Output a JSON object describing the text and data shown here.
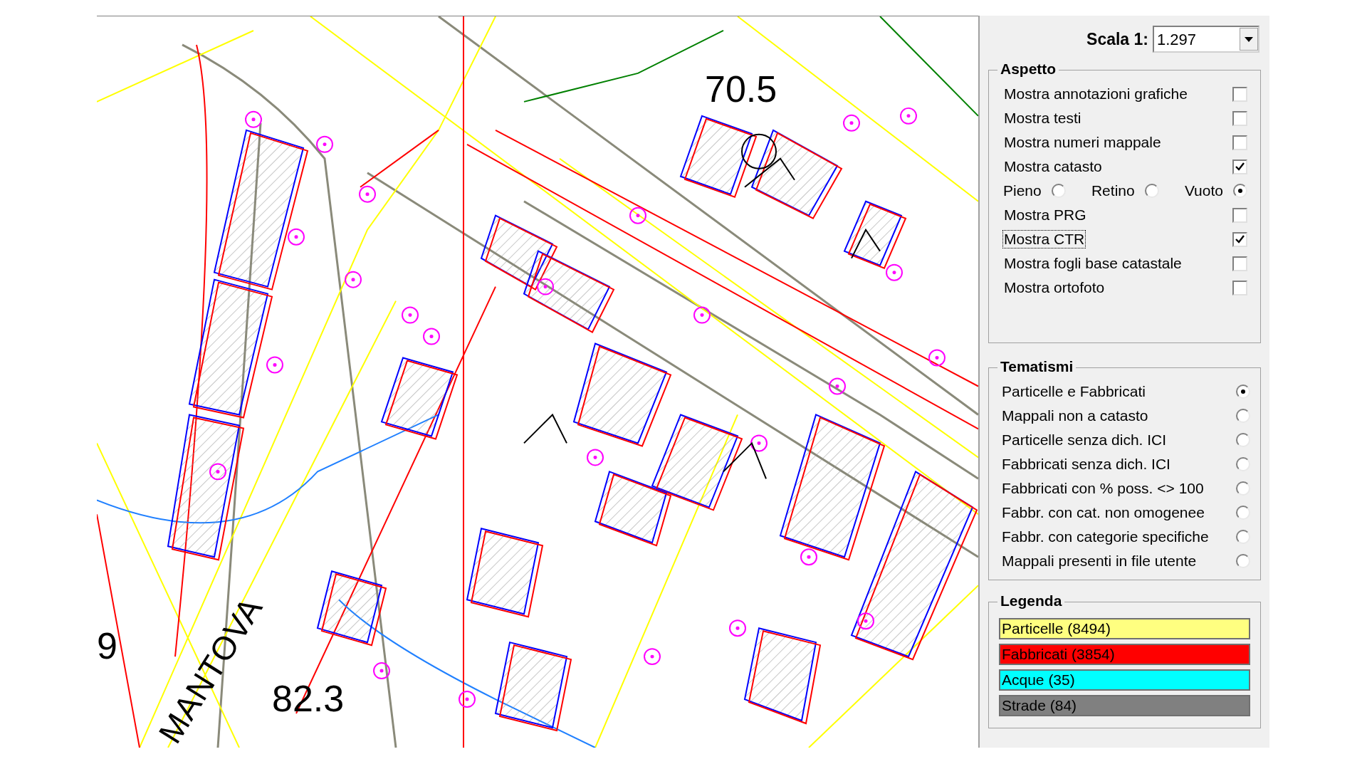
{
  "map": {
    "labels": [
      {
        "kind": "elevation",
        "text": "70.5"
      },
      {
        "kind": "elevation",
        "text": "82.3"
      },
      {
        "kind": "edge",
        "text": "9"
      },
      {
        "kind": "street",
        "text": "MANTOVA"
      }
    ]
  },
  "scale": {
    "label": "Scala 1:",
    "value": "1.297"
  },
  "aspetto": {
    "title": "Aspetto",
    "rows": [
      {
        "kind": "checkbox",
        "label": "Mostra annotazioni grafiche",
        "checked": false,
        "focused": false
      },
      {
        "kind": "checkbox",
        "label": "Mostra testi",
        "checked": false,
        "focused": false
      },
      {
        "kind": "checkbox",
        "label": "Mostra numeri mappale",
        "checked": false,
        "focused": false
      },
      {
        "kind": "checkbox",
        "label": "Mostra catasto",
        "checked": true,
        "focused": false
      },
      {
        "kind": "radios",
        "options": [
          {
            "label": "Pieno",
            "selected": false
          },
          {
            "label": "Retino",
            "selected": false
          },
          {
            "label": "Vuoto",
            "selected": true
          }
        ]
      },
      {
        "kind": "checkbox",
        "label": "Mostra PRG",
        "checked": false,
        "focused": false
      },
      {
        "kind": "checkbox",
        "label": "Mostra CTR",
        "checked": true,
        "focused": true
      },
      {
        "kind": "checkbox",
        "label": "Mostra fogli base catastale",
        "checked": false,
        "focused": false
      },
      {
        "kind": "checkbox",
        "label": "Mostra ortofoto",
        "checked": false,
        "focused": false
      }
    ]
  },
  "tematismi": {
    "title": "Tematismi",
    "options": [
      {
        "label": "Particelle e Fabbricati",
        "selected": true
      },
      {
        "label": "Mappali non a catasto",
        "selected": false
      },
      {
        "label": "Particelle senza dich. ICI",
        "selected": false
      },
      {
        "label": "Fabbricati senza dich. ICI",
        "selected": false
      },
      {
        "label": "Fabbricati con % poss. <> 100",
        "selected": false
      },
      {
        "label": "Fabbr. con cat. non omogenee",
        "selected": false
      },
      {
        "label": "Fabbr. con categorie specifiche",
        "selected": false
      },
      {
        "label": "Mappali presenti in file utente",
        "selected": false
      }
    ]
  },
  "legenda": {
    "title": "Legenda",
    "items": [
      {
        "label": "Particelle (8494)",
        "color": "#ffff80"
      },
      {
        "label": "Fabbricati (3854)",
        "color": "#ff0000"
      },
      {
        "label": "Acque (35)",
        "color": "#00ffff"
      },
      {
        "label": "Strade (84)",
        "color": "#808080"
      }
    ]
  }
}
